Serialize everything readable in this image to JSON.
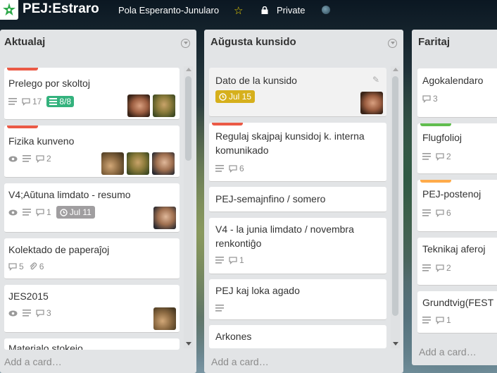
{
  "header": {
    "board_title": "PEJ:Estraro",
    "org_name": "Pola Esperanto-Junularo",
    "privacy": "Private"
  },
  "colors": {
    "label_red": "#eb5a46",
    "label_green": "#61bd4f",
    "label_orange": "#ffab4a",
    "checklist_done": "#34b27d",
    "due_soon": "#d6b01c",
    "due_past": "#a09ea0",
    "list_bg": "#e2e4e6"
  },
  "lists": [
    {
      "title": "Aktualaj",
      "add_card": "Add a card…",
      "cards": [
        {
          "title": "Prelego por skoltoj",
          "label": "red",
          "description": true,
          "comments": "17",
          "checklist": "8/8",
          "avatars": 2
        },
        {
          "title": "Fizika kunveno",
          "label": "red",
          "watching": true,
          "description": true,
          "comments": "2",
          "avatars": 3
        },
        {
          "title": "V4;Aŭtuna limdato - resumo",
          "watching": true,
          "description": true,
          "comments": "1",
          "due": "Jul 11",
          "avatars": 1
        },
        {
          "title": "Kolektado de paperaĵoj",
          "comments": "5",
          "attachments": "6"
        },
        {
          "title": "JES2015",
          "watching": true,
          "description": true,
          "comments": "3",
          "avatars": 1
        },
        {
          "title": "Materialo stokejo"
        }
      ]
    },
    {
      "title": "Aŭgusta kunsido",
      "add_card": "Add a card…",
      "cards": [
        {
          "title": "Dato de la kunsido",
          "due": "Jul 15",
          "avatars": 1
        },
        {
          "title": "Regulaj skajpaj kunsidoj k. interna komunikado",
          "label": "red",
          "description": true,
          "comments": "6"
        },
        {
          "title": "PEJ-semajnfino / somero"
        },
        {
          "title": "V4 - la junia limdato / novembra renkontiĝo",
          "description": true,
          "comments": "1"
        },
        {
          "title": "PEJ kaj loka agado",
          "description": true
        },
        {
          "title": "Arkones"
        }
      ]
    },
    {
      "title": "Faritaj",
      "add_card": "Add a card…",
      "cards": [
        {
          "title": "Agokalendaro",
          "comments": "3"
        },
        {
          "title": "Flugfolioj",
          "label": "green",
          "description": true,
          "comments": "2"
        },
        {
          "title": "PEJ-postenoj",
          "label": "orange",
          "description": true,
          "comments": "6"
        },
        {
          "title": "Teknikaj aferoj",
          "description": true,
          "comments": "2"
        },
        {
          "title": "Grundtvig(FEST",
          "description": true,
          "comments": "1"
        }
      ]
    }
  ]
}
